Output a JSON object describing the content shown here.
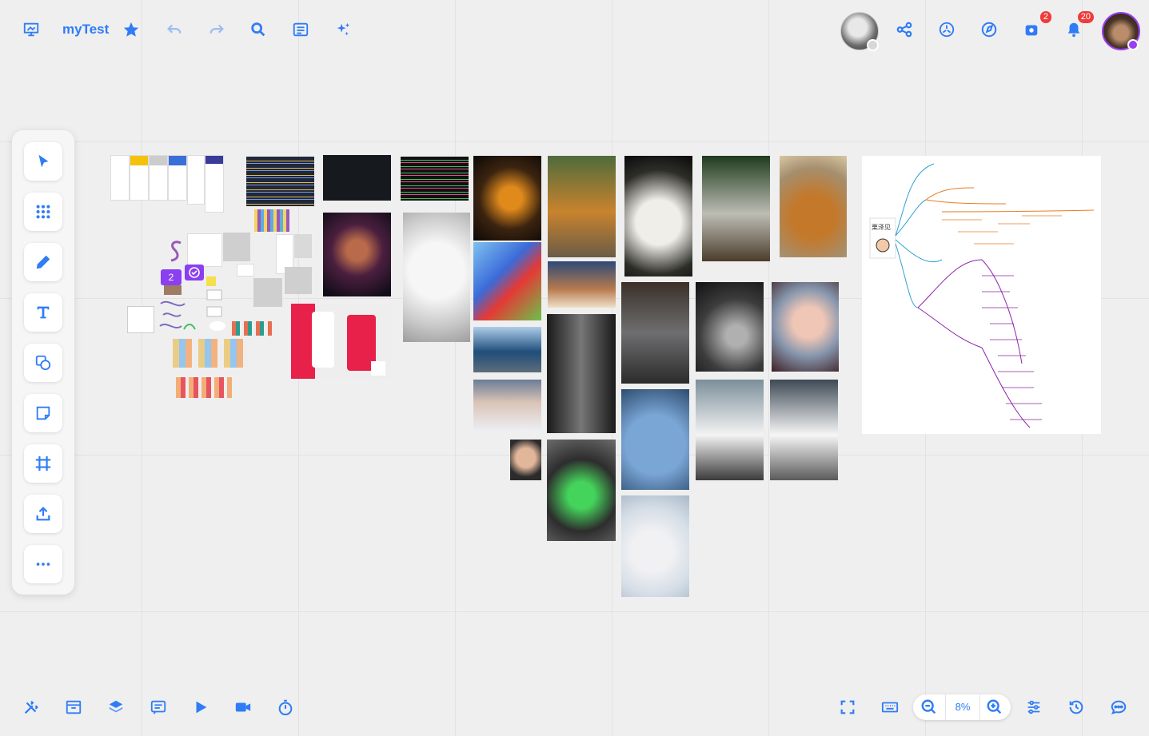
{
  "board": {
    "title": "myTest"
  },
  "topbar": {
    "share_badge": "2",
    "notification_badge": "20"
  },
  "bottombar": {
    "zoom": "8%"
  },
  "canvas": {
    "collection_badge": "2",
    "mindmap_name": "栗泽见"
  },
  "colors": {
    "accent": "#2f7cf6",
    "badge": "#ef3b3b",
    "purple": "#9b3ff0"
  }
}
